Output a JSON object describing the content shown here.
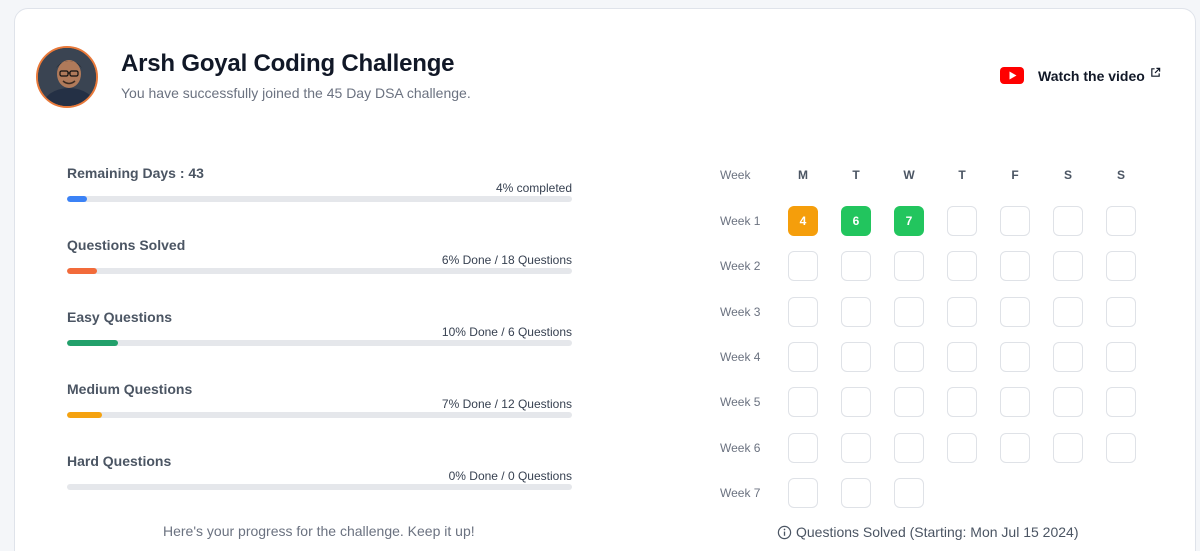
{
  "header": {
    "title": "Arsh Goyal Coding Challenge",
    "subtitle": "You have successfully joined the 45 Day DSA challenge.",
    "watch_label": "Watch the video"
  },
  "stats": [
    {
      "label": "Remaining Days : ",
      "value": "43",
      "right": "4% completed",
      "percent": 4,
      "color": "#3b82f6"
    },
    {
      "label": "Questions Solved",
      "value": "",
      "right": "6% Done / 18 Questions",
      "percent": 6,
      "color": "#f26b3a"
    },
    {
      "label": "Easy Questions",
      "value": "",
      "right": "10% Done / 6 Questions",
      "percent": 10,
      "color": "#22a06b"
    },
    {
      "label": "Medium Questions",
      "value": "",
      "right": "7% Done / 12 Questions",
      "percent": 7,
      "color": "#f5a20f"
    },
    {
      "label": "Hard Questions",
      "value": "",
      "right": "0% Done / 0 Questions",
      "percent": 0,
      "color": "#9ca3af"
    }
  ],
  "progress_message": "Here's your progress for the challenge. Keep it up!",
  "calendar": {
    "week_header": "Week",
    "days": [
      "M",
      "T",
      "W",
      "T",
      "F",
      "S",
      "S"
    ],
    "weeks": [
      {
        "label": "Week 1",
        "cells": [
          {
            "value": "4",
            "color": "#f59e0b"
          },
          {
            "value": "6",
            "color": "#22c55e"
          },
          {
            "value": "7",
            "color": "#22c55e"
          },
          null,
          null,
          null,
          null
        ]
      },
      {
        "label": "Week 2",
        "cells": [
          null,
          null,
          null,
          null,
          null,
          null,
          null
        ]
      },
      {
        "label": "Week 3",
        "cells": [
          null,
          null,
          null,
          null,
          null,
          null,
          null
        ]
      },
      {
        "label": "Week 4",
        "cells": [
          null,
          null,
          null,
          null,
          null,
          null,
          null
        ]
      },
      {
        "label": "Week 5",
        "cells": [
          null,
          null,
          null,
          null,
          null,
          null,
          null
        ]
      },
      {
        "label": "Week 6",
        "cells": [
          null,
          null,
          null,
          null,
          null,
          null,
          null
        ]
      },
      {
        "label": "Week 7",
        "cells": [
          null,
          null,
          null
        ]
      }
    ],
    "footer": "Questions Solved (Starting: Mon Jul 15 2024)"
  },
  "colors": {
    "accent_orange": "#e8793a",
    "youtube_red": "#ff0000"
  },
  "icons": {
    "video": "youtube-icon",
    "external": "external-link-icon",
    "info": "info-icon"
  }
}
